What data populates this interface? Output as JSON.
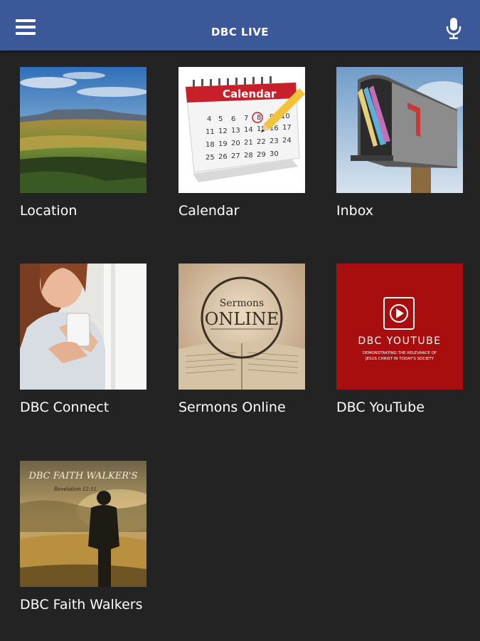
{
  "header": {
    "title": "DBC LIVE",
    "color": "#3b5998",
    "menu_icon": "hamburger-menu-icon",
    "mic_icon": "microphone-icon"
  },
  "tiles": [
    {
      "label": "Location"
    },
    {
      "label": "Calendar",
      "image_text": "Calendar"
    },
    {
      "label": "Inbox"
    },
    {
      "label": "DBC Connect"
    },
    {
      "label": "Sermons Online",
      "image_text": [
        "Sermons",
        "ONLINE"
      ]
    },
    {
      "label": "DBC YouTube",
      "image_text": [
        "DBC YOUTUBE",
        "DEMONSTRATING THE RELEVANCE OF",
        "JESUS CHRIST IN TODAY'S SOCIETY"
      ]
    },
    {
      "label": "DBC Faith Walkers",
      "image_text": [
        "DBC FAITH WALKER'S",
        "Revelation 12:11"
      ]
    }
  ],
  "background": "#232323"
}
